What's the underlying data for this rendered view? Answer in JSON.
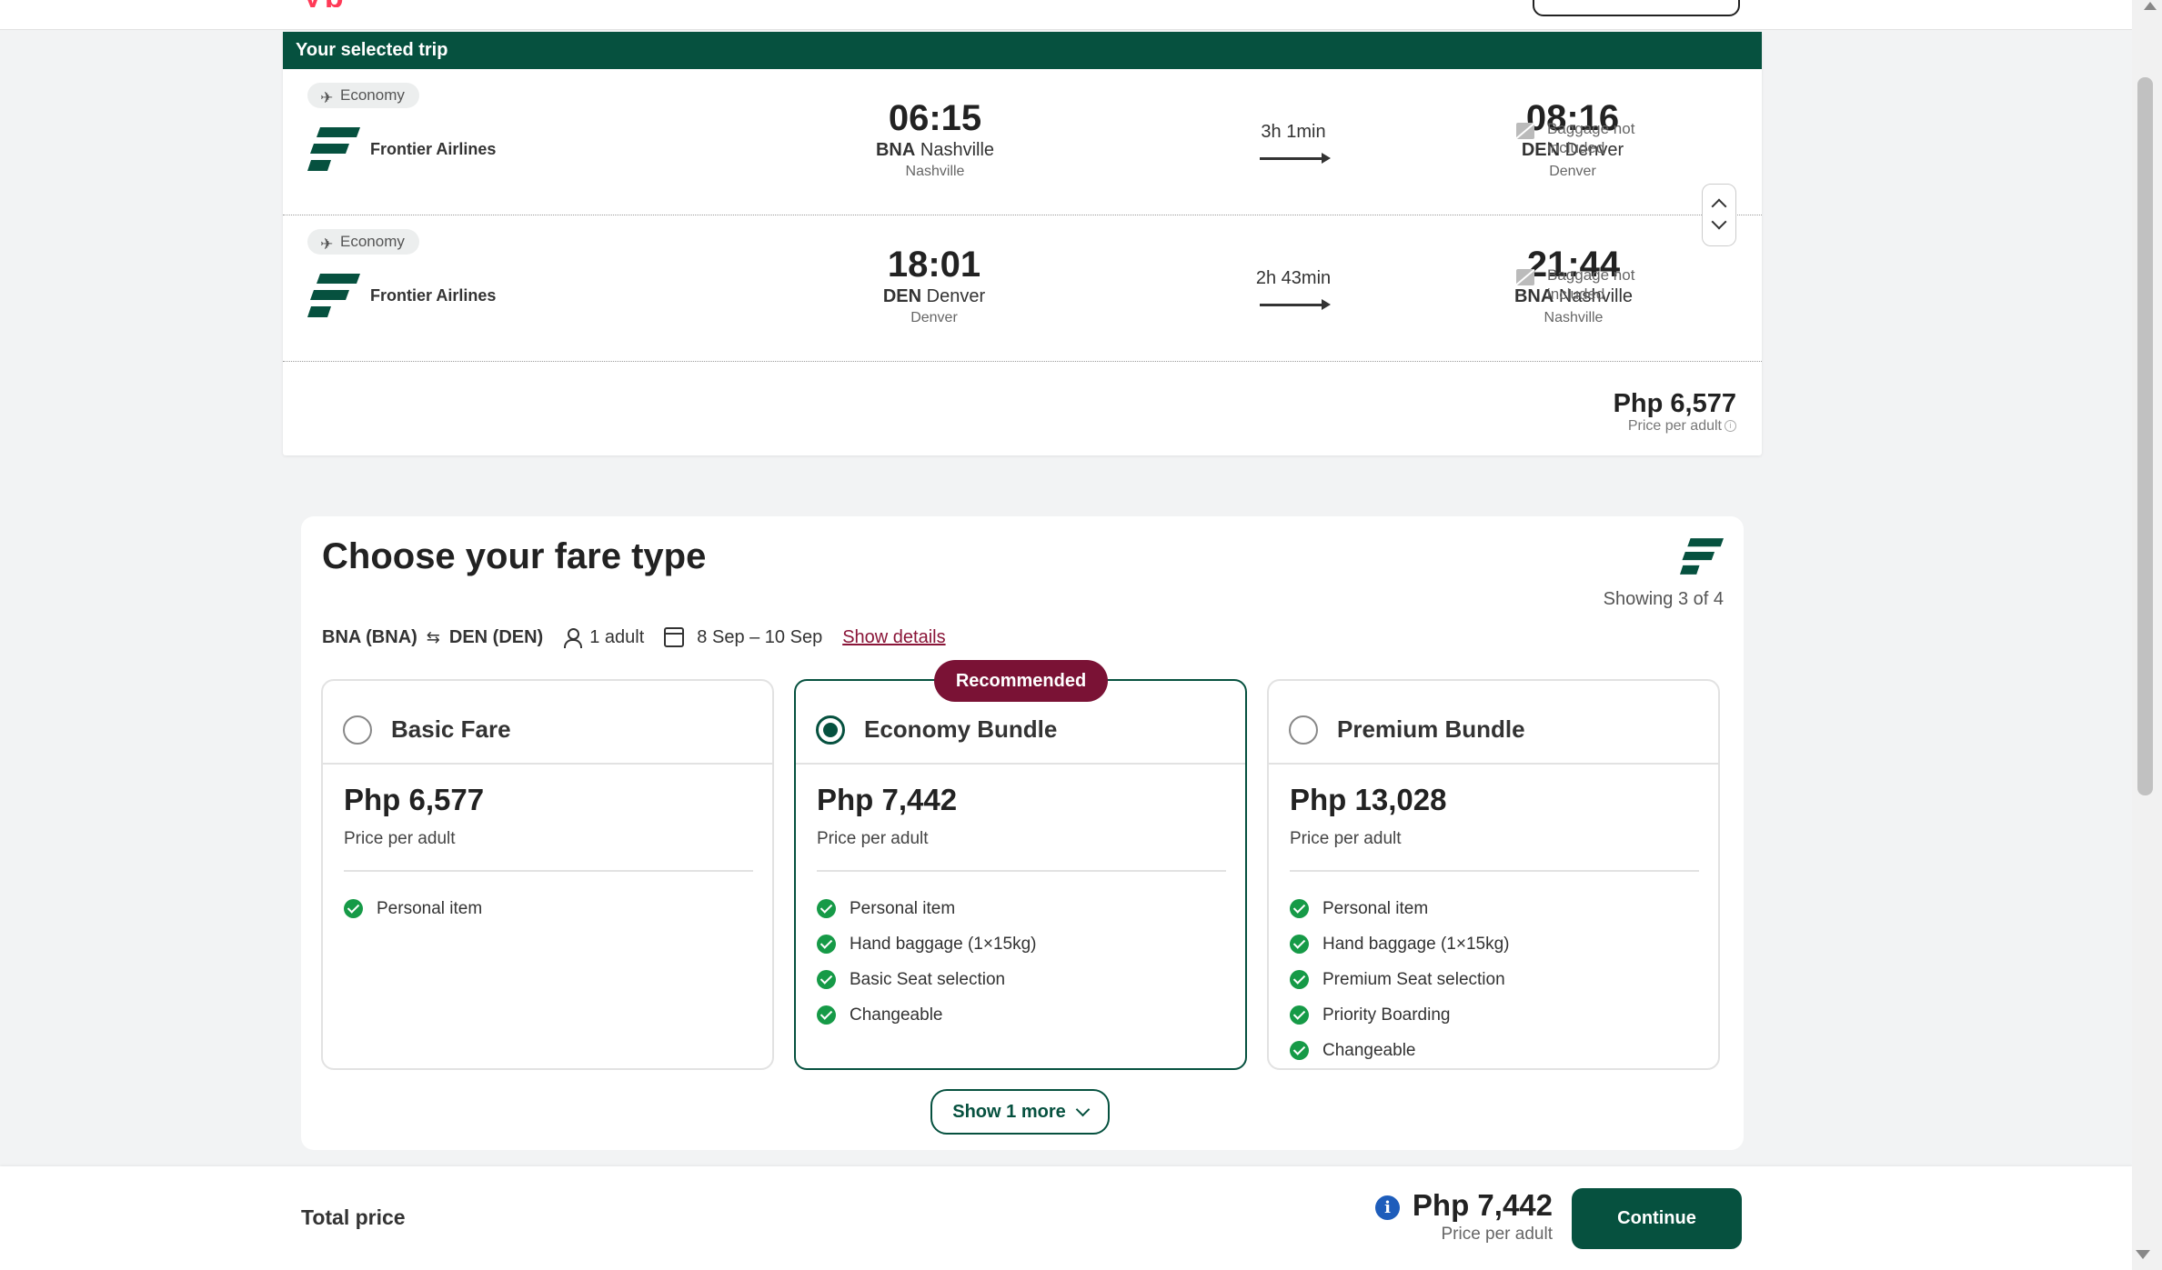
{
  "header": {
    "brand_fragment": "yp",
    "brand_color": "#ff3a57"
  },
  "trip": {
    "heading": "Your selected trip",
    "segments": [
      {
        "cabin": "Economy",
        "airline": "Frontier Airlines",
        "depart": {
          "time": "06:15",
          "code": "BNA",
          "airport": "Nashville",
          "city": "Nashville"
        },
        "duration": "3h 1min",
        "arrive": {
          "time": "08:16",
          "code": "DEN",
          "airport": "Denver",
          "city": "Denver"
        },
        "baggage": "Baggage not included"
      },
      {
        "cabin": "Economy",
        "airline": "Frontier Airlines",
        "depart": {
          "time": "18:01",
          "code": "DEN",
          "airport": "Denver",
          "city": "Denver"
        },
        "duration": "2h 43min",
        "arrive": {
          "time": "21:44",
          "code": "BNA",
          "airport": "Nashville",
          "city": "Nashville"
        },
        "baggage": "Baggage not included"
      }
    ],
    "price": "Php 6,577",
    "price_label": "Price per adult"
  },
  "fare": {
    "title": "Choose your fare type",
    "showing": "Showing 3 of 4",
    "route": {
      "from": "BNA (BNA)",
      "to": "DEN (DEN)",
      "passengers": "1 adult",
      "dates": "8 Sep – 10 Sep",
      "show_details": "Show details"
    },
    "recommended_badge": "Recommended",
    "cards": [
      {
        "name": "Basic Fare",
        "price": "Php 6,577",
        "price_label": "Price per adult",
        "selected": false,
        "features": [
          "Personal item"
        ]
      },
      {
        "name": "Economy Bundle",
        "price": "Php 7,442",
        "price_label": "Price per adult",
        "selected": true,
        "features": [
          "Personal item",
          "Hand baggage (1×15kg)",
          "Basic Seat selection",
          "Changeable"
        ]
      },
      {
        "name": "Premium Bundle",
        "price": "Php 13,028",
        "price_label": "Price per adult",
        "selected": false,
        "features": [
          "Personal item",
          "Hand baggage (1×15kg)",
          "Premium Seat selection",
          "Priority Boarding",
          "Changeable"
        ]
      }
    ],
    "show_more": "Show 1 more"
  },
  "footer": {
    "total_label": "Total price",
    "total": "Php 7,442",
    "total_sub": "Price per adult",
    "continue": "Continue"
  },
  "colors": {
    "primary": "#06513f",
    "badge": "#7a1235",
    "check": "#169a47",
    "info": "#1e5dbb"
  }
}
